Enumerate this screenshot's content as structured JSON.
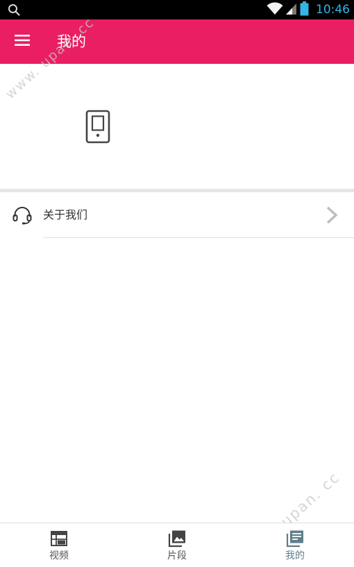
{
  "status_bar": {
    "time": "10:46",
    "left_icon": "search-icon",
    "right_icons": [
      "wifi-icon",
      "signal-icon",
      "battery-icon"
    ]
  },
  "app_bar": {
    "title": "我的",
    "menu_icon": "menu-icon"
  },
  "header": {
    "icon": "phone-icon"
  },
  "list": {
    "items": [
      {
        "label": "关于我们",
        "icon": "headset-icon",
        "trailing_icon": "chevron-right-icon"
      }
    ]
  },
  "bottom_nav": {
    "tabs": [
      {
        "label": "视频",
        "icon": "calendar-grid-icon",
        "active": false
      },
      {
        "label": "片段",
        "icon": "image-icon",
        "active": false
      },
      {
        "label": "我的",
        "icon": "news-icon",
        "active": true
      }
    ]
  },
  "watermarks": [
    {
      "text": "www. upan. cc"
    },
    {
      "text": "www. upan. cc"
    }
  ],
  "colors": {
    "app_bar": "#e91e63",
    "status_bar": "#000000",
    "status_accent": "#33b5e5",
    "nav_active": "#607d8b",
    "nav_inactive": "#555555",
    "divider": "#e0e0e0"
  }
}
